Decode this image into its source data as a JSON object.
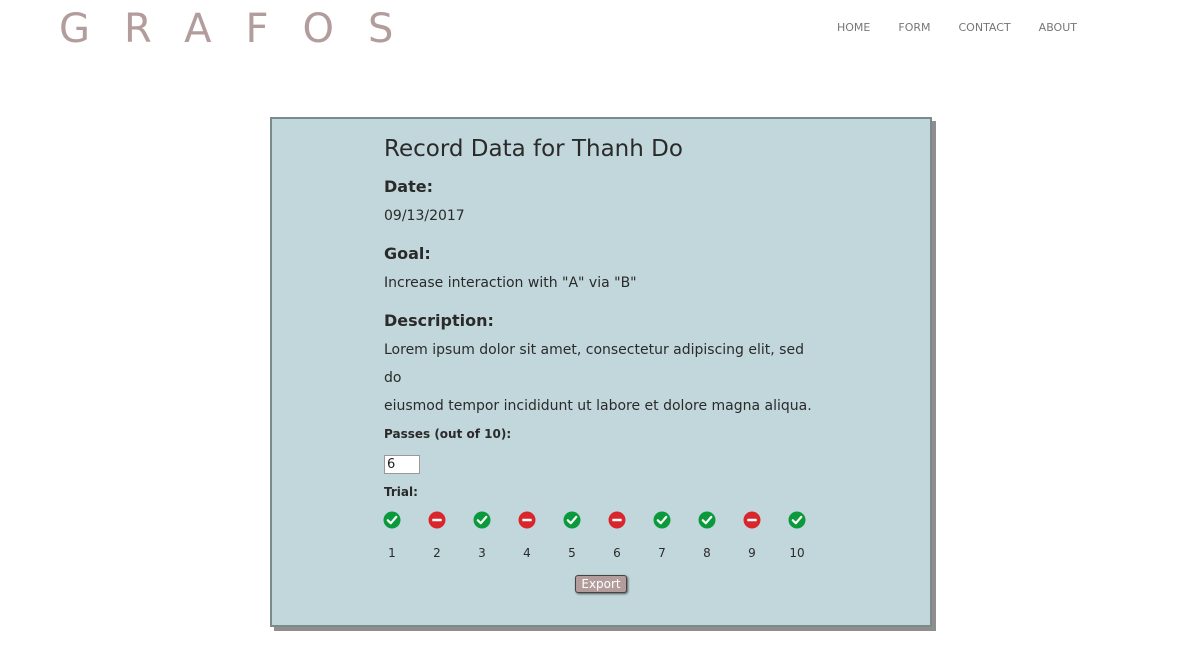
{
  "brand": {
    "logo": "GRAFOS"
  },
  "nav": {
    "home": "HOME",
    "form": "FORM",
    "contact": "CONTACT",
    "about": "ABOUT"
  },
  "record": {
    "title": "Record Data for Thanh Do",
    "date_label": "Date:",
    "date_value": "09/13/2017",
    "goal_label": "Goal:",
    "goal_value": "Increase interaction with \"A\" via \"B\"",
    "description_label": "Description:",
    "description_line1": "Lorem ipsum dolor sit amet, consectetur adipiscing elit, sed do",
    "description_line2": "eiusmod tempor incididunt ut labore et dolore magna aliqua.",
    "passes_label": "Passes (out of 10):",
    "passes_value": "6",
    "trial_label": "Trial:",
    "export_label": "Export"
  },
  "trials": [
    {
      "number": "1",
      "result": "pass"
    },
    {
      "number": "2",
      "result": "fail"
    },
    {
      "number": "3",
      "result": "pass"
    },
    {
      "number": "4",
      "result": "fail"
    },
    {
      "number": "5",
      "result": "pass"
    },
    {
      "number": "6",
      "result": "fail"
    },
    {
      "number": "7",
      "result": "pass"
    },
    {
      "number": "8",
      "result": "pass"
    },
    {
      "number": "9",
      "result": "fail"
    },
    {
      "number": "10",
      "result": "pass"
    }
  ],
  "colors": {
    "pass": "#0a9a3c",
    "fail": "#d9262c",
    "brand": "#b29c9c",
    "card_bg": "#c2d7dc"
  },
  "icons": {
    "pass": "check-circle-icon",
    "fail": "minus-circle-icon"
  }
}
